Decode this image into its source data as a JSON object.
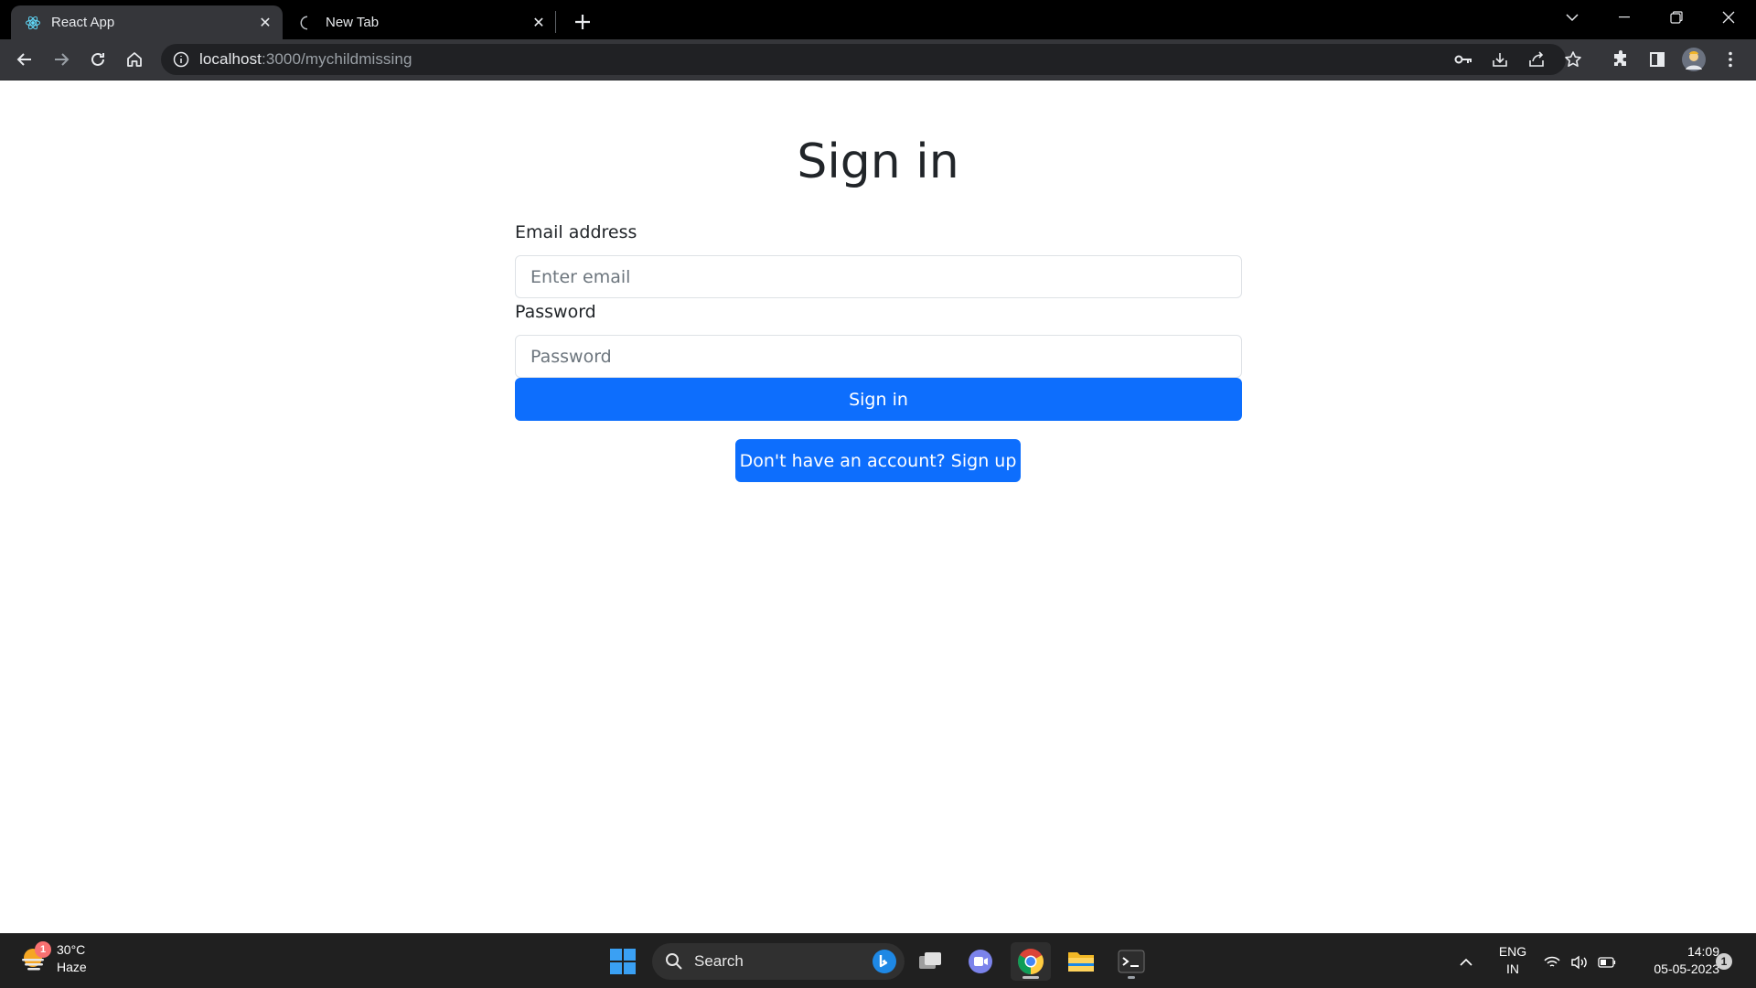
{
  "browser": {
    "tabs": [
      {
        "title": "React App",
        "icon": "react-icon",
        "active": true
      },
      {
        "title": "New Tab",
        "icon": "loading-spinner-icon",
        "active": false
      }
    ],
    "address": {
      "host": "localhost",
      "path": ":3000/mychildmissing"
    }
  },
  "page": {
    "heading": "Sign in",
    "email": {
      "label": "Email address",
      "placeholder": "Enter email",
      "value": ""
    },
    "password": {
      "label": "Password",
      "placeholder": "Password",
      "value": ""
    },
    "submit_label": "Sign in",
    "signup_label": "Don't have an account? Sign up",
    "colors": {
      "primary": "#0d6efd",
      "text": "#212529",
      "border": "#dee2e6"
    }
  },
  "taskbar": {
    "weather": {
      "temp": "30°C",
      "condition": "Haze",
      "badge": "1"
    },
    "search_label": "Search",
    "lang": {
      "line1": "ENG",
      "line2": "IN"
    },
    "clock": {
      "time": "14:09",
      "date": "05-05-2023"
    },
    "notification_count": "1"
  }
}
